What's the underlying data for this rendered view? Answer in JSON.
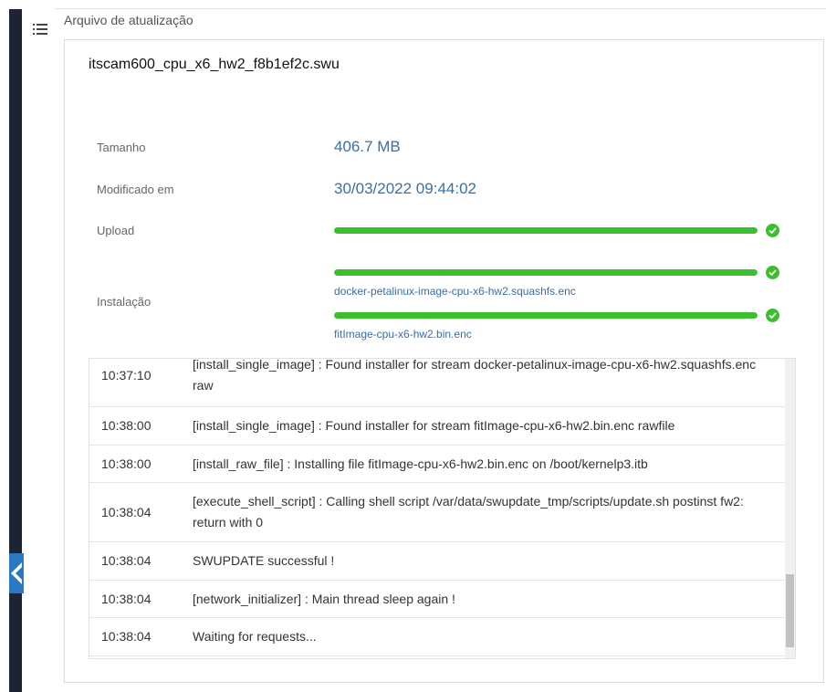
{
  "breadcrumb": "Arquivo de atualização",
  "file": {
    "name": "itscam600_cpu_x6_hw2_f8b1ef2c.swu"
  },
  "info": {
    "size_label": "Tamanho",
    "size_value": "406.7 MB",
    "modified_label": "Modificado em",
    "modified_value": "30/03/2022 09:44:02",
    "upload_label": "Upload",
    "upload_progress": 100,
    "install_label": "Instalação",
    "install_items": [
      {
        "file": "docker-petalinux-image-cpu-x6-hw2.squashfs.enc",
        "progress": 100
      },
      {
        "file": "fitImage-cpu-x6-hw2.bin.enc",
        "progress": 100
      }
    ]
  },
  "log": [
    {
      "time": "10:37:10",
      "message": "[install_single_image] : Found installer for stream docker-petalinux-image-cpu-x6-hw2.squashfs.enc raw"
    },
    {
      "time": "10:38:00",
      "message": "[install_single_image] : Found installer for stream fitImage-cpu-x6-hw2.bin.enc rawfile"
    },
    {
      "time": "10:38:00",
      "message": "[install_raw_file] : Installing file fitImage-cpu-x6-hw2.bin.enc on /boot/kernelp3.itb"
    },
    {
      "time": "10:38:04",
      "message": "[execute_shell_script] : Calling shell script /var/data/swupdate_tmp/scripts/update.sh postinst fw2: return with 0"
    },
    {
      "time": "10:38:04",
      "message": "SWUPDATE successful !"
    },
    {
      "time": "10:38:04",
      "message": "[network_initializer] : Main thread sleep again !"
    },
    {
      "time": "10:38:04",
      "message": "Waiting for requests..."
    }
  ],
  "icons": {
    "menu": "list-menu-icon",
    "check": "check-circle-icon",
    "collapse": "chevron-left-icon"
  },
  "colors": {
    "accent": "#3b6ea5",
    "success": "#3cbf2e",
    "rail": "#1b2430",
    "tab": "#2a78c2"
  }
}
